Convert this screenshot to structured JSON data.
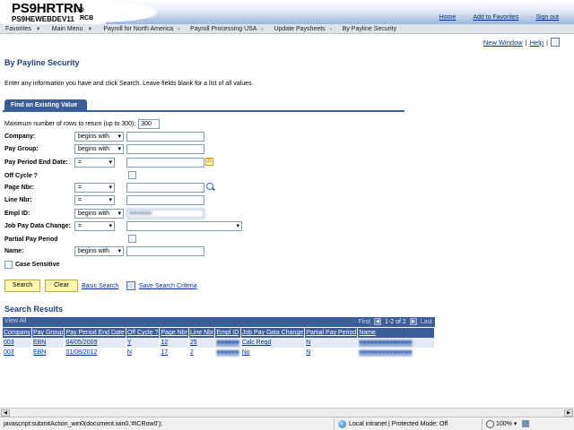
{
  "header": {
    "app_name": "PS9HRTRN",
    "version": "8.50",
    "database": "PS9HEWEBDEV11",
    "user": "RCB",
    "links": [
      "Home",
      "Add to Favorites",
      "Sign out"
    ]
  },
  "breadcrumb": [
    "Favorites",
    "Main Menu",
    "Payroll for North America",
    "Payroll Processing USA",
    "Update Paysheets",
    "By Payline Security"
  ],
  "page_links": {
    "new_window": "New Window",
    "help": "Help",
    "sep": "|"
  },
  "page": {
    "title": "By Payline Security",
    "instructions": "Enter any information you have and click Search. Leave fields blank for a list of all values.",
    "tab": "Find an Existing Value",
    "max_rows_label": "Maximum number of rows to return (up to 300):",
    "max_rows_value": "300"
  },
  "fields": [
    {
      "label": "Company:",
      "operator": "begins with",
      "value": ""
    },
    {
      "label": "Pay Group:",
      "operator": "begins with",
      "value": ""
    },
    {
      "label": "Pay Period End Date:",
      "operator": "=",
      "value": ""
    },
    {
      "label": "Off Cycle ?",
      "operator": "",
      "value": ""
    },
    {
      "label": "Page Nbr:",
      "operator": "=",
      "value": ""
    },
    {
      "label": "Line Nbr:",
      "operator": "=",
      "value": ""
    },
    {
      "label": "Empl ID:",
      "operator": "begins with",
      "value": "■■■■■■"
    },
    {
      "label": "Job Pay Data Change:",
      "operator": "=",
      "value": ""
    },
    {
      "label": "Partial Pay Period",
      "operator": "",
      "value": ""
    },
    {
      "label": "Name:",
      "operator": "begins with",
      "value": ""
    }
  ],
  "case_sensitive_label": "Case Sensitive",
  "buttons": {
    "search": "Search",
    "clear": "Clear",
    "basic_search": "Basic Search",
    "save_criteria": "Save Search Criteria"
  },
  "results": {
    "title": "Search Results",
    "view_all": "View All",
    "first": "First",
    "page_info": "1-2 of 2",
    "last": "Last",
    "columns": [
      "Company",
      "Pay Group",
      "Pay Period End Date",
      "Off Cycle ?",
      "Page Nbr",
      "Line Nbr",
      "Empl ID",
      "Job Pay Data Change",
      "Partial Pay Period",
      "Name"
    ],
    "rows": [
      [
        "003",
        "EBN",
        "04/05/2009",
        "Y",
        "12",
        "25",
        "■■■■■■",
        "Calc Reqd",
        "N",
        "■■■■■■■■■■■■■■"
      ],
      [
        "003",
        "EBN",
        "01/08/2012",
        "N",
        "17",
        "2",
        "■■■■■■",
        "No",
        "N",
        "■■■■■■■■■■■■■■"
      ]
    ]
  },
  "statusbar": {
    "status_text": "javascript:submitAction_win0(document.win0,'#ICRow0');",
    "zone": "Local intranet | Protected Mode: Off",
    "zoom": "100%"
  }
}
